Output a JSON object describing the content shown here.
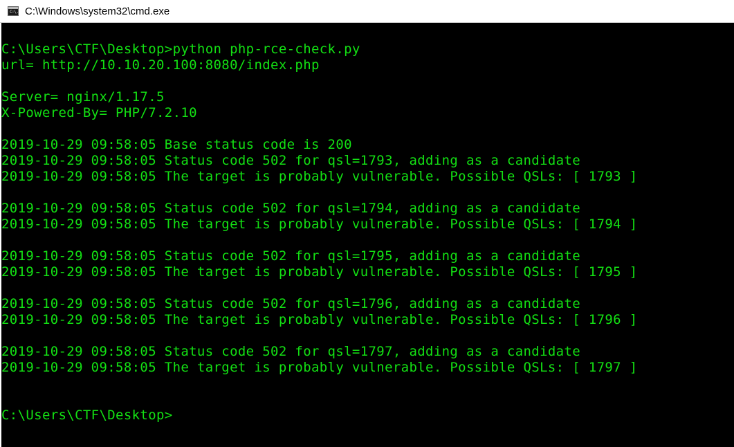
{
  "window": {
    "title": "C:\\Windows\\system32\\cmd.exe",
    "icon": "cmd-icon",
    "icon_glyph": "C:\\."
  },
  "colors": {
    "console_background": "#000000",
    "console_text": "#13e013",
    "titlebar_background": "#ffffff"
  },
  "console": {
    "lines": [
      "C:\\Users\\CTF\\Desktop>python php-rce-check.py",
      "url= http://10.10.20.100:8080/index.php",
      "",
      "Server= nginx/1.17.5",
      "X-Powered-By= PHP/7.2.10",
      "",
      "2019-10-29 09:58:05 Base status code is 200",
      "2019-10-29 09:58:05 Status code 502 for qsl=1793, adding as a candidate",
      "2019-10-29 09:58:05 The target is probably vulnerable. Possible QSLs: [ 1793 ]",
      "",
      "2019-10-29 09:58:05 Status code 502 for qsl=1794, adding as a candidate",
      "2019-10-29 09:58:05 The target is probably vulnerable. Possible QSLs: [ 1794 ]",
      "",
      "2019-10-29 09:58:05 Status code 502 for qsl=1795, adding as a candidate",
      "2019-10-29 09:58:05 The target is probably vulnerable. Possible QSLs: [ 1795 ]",
      "",
      "2019-10-29 09:58:05 Status code 502 for qsl=1796, adding as a candidate",
      "2019-10-29 09:58:05 The target is probably vulnerable. Possible QSLs: [ 1796 ]",
      "",
      "2019-10-29 09:58:05 Status code 502 for qsl=1797, adding as a candidate",
      "2019-10-29 09:58:05 The target is probably vulnerable. Possible QSLs: [ 1797 ]",
      "",
      "",
      "C:\\Users\\CTF\\Desktop>"
    ]
  }
}
